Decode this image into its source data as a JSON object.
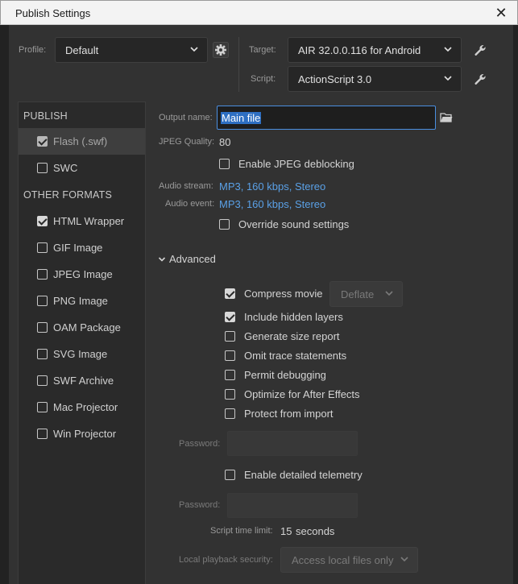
{
  "window": {
    "title": "Publish Settings",
    "close_glyph": "✕"
  },
  "profile": {
    "label": "Profile:",
    "value": "Default"
  },
  "target": {
    "label": "Target:",
    "value": "AIR 32.0.0.116 for Android"
  },
  "script": {
    "label": "Script:",
    "value": "ActionScript 3.0"
  },
  "icons": {
    "profile_settings": "gear-icon",
    "wrench": "wrench-icon",
    "folder": "folder-icon",
    "chevron": "chevron-down-icon"
  },
  "sidebar": {
    "publish_header": "PUBLISH",
    "other_header": "OTHER FORMATS",
    "publish_items": [
      {
        "label": "Flash (.swf)",
        "checked": true,
        "selected": true
      },
      {
        "label": "SWC",
        "checked": false,
        "selected": false
      }
    ],
    "other_items": [
      {
        "label": "HTML Wrapper",
        "checked": true
      },
      {
        "label": "GIF Image",
        "checked": false
      },
      {
        "label": "JPEG Image",
        "checked": false
      },
      {
        "label": "PNG Image",
        "checked": false
      },
      {
        "label": "OAM Package",
        "checked": false
      },
      {
        "label": "SVG Image",
        "checked": false
      },
      {
        "label": "SWF Archive",
        "checked": false
      },
      {
        "label": "Mac Projector",
        "checked": false
      },
      {
        "label": "Win Projector",
        "checked": false
      }
    ]
  },
  "main": {
    "output_name": {
      "label": "Output name:",
      "value": "Main file"
    },
    "jpeg_quality": {
      "label": "JPEG Quality:",
      "value": "80"
    },
    "jpeg_deblocking": {
      "label": "Enable JPEG deblocking",
      "checked": false
    },
    "audio_stream": {
      "label": "Audio stream:",
      "value": "MP3, 160 kbps, Stereo"
    },
    "audio_event": {
      "label": "Audio event:",
      "value": "MP3, 160 kbps, Stereo"
    },
    "override_sound": {
      "label": "Override sound settings",
      "checked": false
    },
    "advanced": {
      "label": "Advanced"
    },
    "compress_movie": {
      "label": "Compress movie",
      "checked": true,
      "method": "Deflate"
    },
    "options": [
      {
        "label": "Include hidden layers",
        "checked": true
      },
      {
        "label": "Generate size report",
        "checked": false
      },
      {
        "label": "Omit trace statements",
        "checked": false
      },
      {
        "label": "Permit debugging",
        "checked": false
      },
      {
        "label": "Optimize for After Effects",
        "checked": false
      },
      {
        "label": "Protect from import",
        "checked": false
      }
    ],
    "password_label": "Password:",
    "telemetry": {
      "label": "Enable detailed telemetry",
      "checked": false
    },
    "password2_label": "Password:",
    "script_time_limit": {
      "label": "Script time limit:",
      "value": "15",
      "unit": "seconds"
    },
    "local_playback": {
      "label": "Local playback security:",
      "value": "Access local files only"
    }
  }
}
